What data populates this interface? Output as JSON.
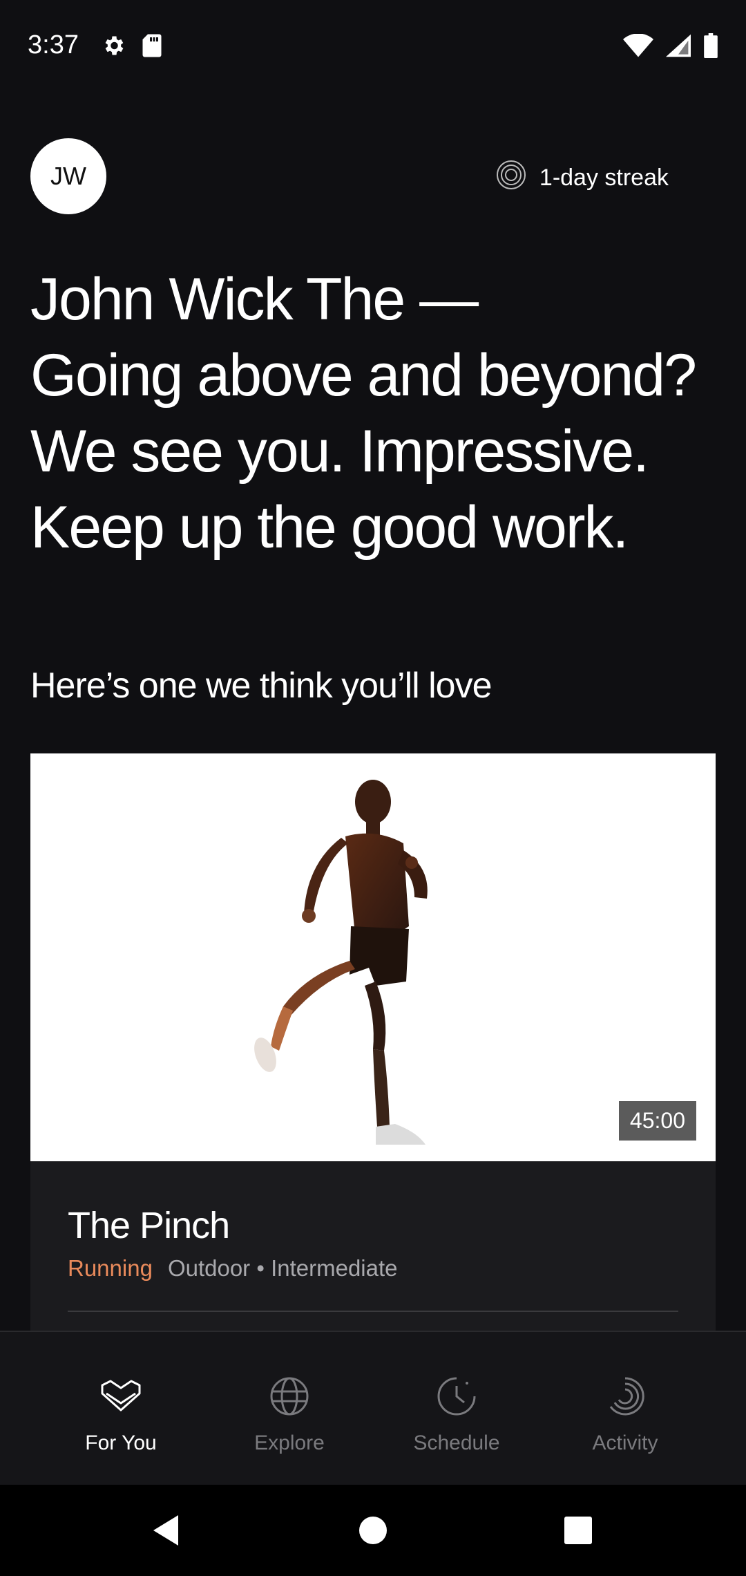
{
  "status_bar": {
    "time": "3:37",
    "icons_left": [
      "gear-icon",
      "sd-card-icon"
    ],
    "icons_right": [
      "wifi-icon",
      "cell-signal-icon",
      "battery-icon"
    ]
  },
  "header": {
    "avatar_initials": "JW",
    "streak_label": "1-day streak",
    "streak_icon": "streak-rings-icon"
  },
  "greeting": {
    "lines": [
      "John Wick The  —",
      "Going above and beyond?",
      "We see you. Impressive.",
      "Keep up the good work."
    ]
  },
  "recommendation": {
    "section_title": "Here’s one we think you’ll love",
    "card": {
      "duration": "45:00",
      "title": "The Pinch",
      "category": "Running",
      "details": "Outdoor • Intermediate"
    }
  },
  "tab_bar": {
    "tabs": [
      {
        "label": "For You",
        "icon": "heart-chevron-icon",
        "active": true
      },
      {
        "label": "Explore",
        "icon": "globe-icon",
        "active": false
      },
      {
        "label": "Schedule",
        "icon": "clock-icon",
        "active": false
      },
      {
        "label": "Activity",
        "icon": "activity-rings-icon",
        "active": false
      }
    ]
  },
  "nav_bar": {
    "buttons": [
      "back-icon",
      "home-icon",
      "recents-icon"
    ]
  },
  "colors": {
    "background": "#0f0f12",
    "accent": "#e98a5b",
    "inactive": "#7a7a7e"
  }
}
